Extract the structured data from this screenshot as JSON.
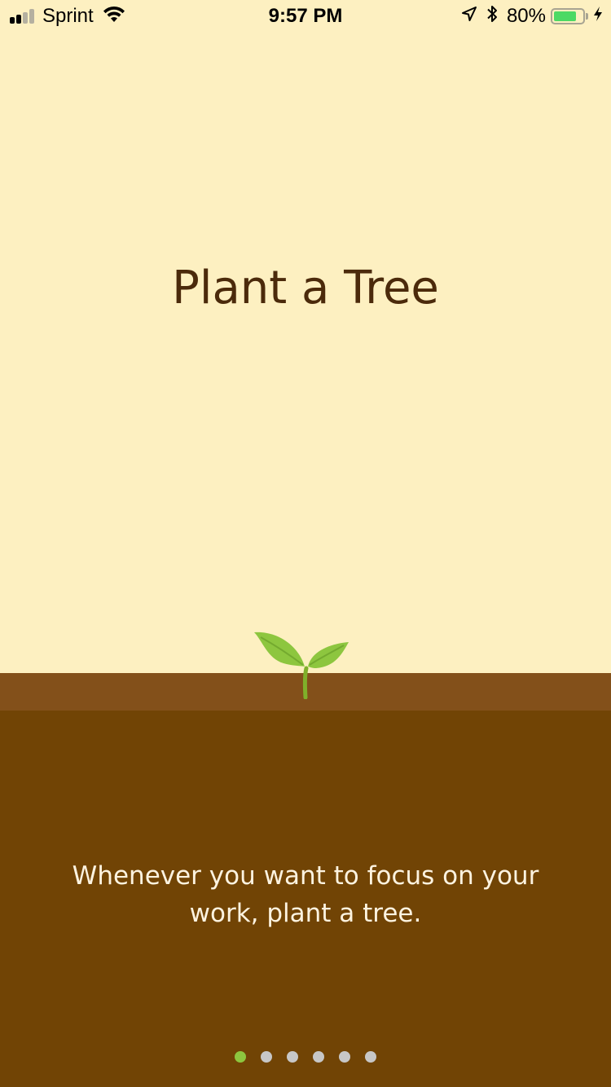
{
  "status_bar": {
    "carrier": "Sprint",
    "time": "9:57 PM",
    "battery_percent": "80%",
    "battery_level": 0.8,
    "signal_bars": 2,
    "signal_max": 4,
    "icons": [
      "signal-icon",
      "wifi-icon",
      "location-arrow-icon",
      "bluetooth-icon",
      "battery-icon",
      "charging-bolt-icon"
    ]
  },
  "onboarding": {
    "title": "Plant a Tree",
    "description": "Whenever you want to focus on your work, plant a tree.",
    "illustration": "sprout-icon",
    "page_count": 6,
    "current_page": 1
  },
  "colors": {
    "sky": "#fdf0c1",
    "ground": "#714405",
    "ground_top": "#83501a",
    "title_text": "#4b2a0b",
    "body_text": "#fdf3e0",
    "sprout": "#8dc63f",
    "dot_active": "#8dc63f",
    "dot_inactive": "#c7c7c7"
  }
}
